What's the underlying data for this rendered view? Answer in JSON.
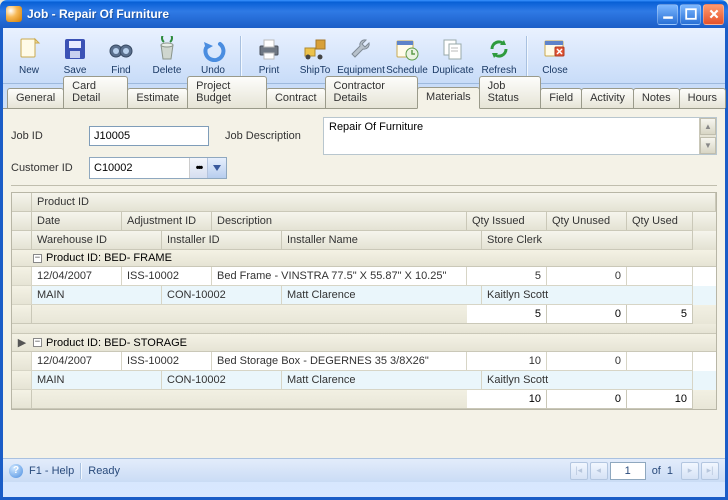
{
  "window": {
    "title": "Job - Repair Of Furniture"
  },
  "toolbar": [
    {
      "name": "new",
      "label": "New"
    },
    {
      "name": "save",
      "label": "Save"
    },
    {
      "name": "find",
      "label": "Find"
    },
    {
      "name": "delete",
      "label": "Delete"
    },
    {
      "name": "undo",
      "label": "Undo"
    },
    {
      "name": "print",
      "label": "Print"
    },
    {
      "name": "shipto",
      "label": "ShipTo"
    },
    {
      "name": "equipment",
      "label": "Equipment"
    },
    {
      "name": "schedule",
      "label": "Schedule"
    },
    {
      "name": "duplicate",
      "label": "Duplicate"
    },
    {
      "name": "refresh",
      "label": "Refresh"
    },
    {
      "name": "close",
      "label": "Close"
    }
  ],
  "tabs": [
    "General",
    "Card Detail",
    "Estimate",
    "Project Budget",
    "Contract",
    "Contractor Details",
    "Materials",
    "Job Status",
    "Field",
    "Activity",
    "Notes",
    "Hours"
  ],
  "active_tab": "Materials",
  "form": {
    "job_id_label": "Job ID",
    "job_id": "J10005",
    "customer_id_label": "Customer ID",
    "customer_id": "C10002",
    "job_desc_label": "Job Description",
    "job_desc": "Repair Of Furniture"
  },
  "grid": {
    "head_product": "Product ID",
    "head_date": "Date",
    "head_adj": "Adjustment ID",
    "head_desc": "Description",
    "head_qty_issued": "Qty Issued",
    "head_qty_unused": "Qty Unused",
    "head_qty_used": "Qty Used",
    "head_wh": "Warehouse ID",
    "head_installer_id": "Installer ID",
    "head_installer_name": "Installer Name",
    "head_clerk": "Store Clerk",
    "groups": [
      {
        "title": "Product ID: BED- FRAME",
        "row": {
          "date": "12/04/2007",
          "adj": "ISS-10002",
          "desc": "Bed Frame - VINSTRA 77.5\" X 55.87\" X 10.25\"",
          "qi": "5",
          "qu": "0",
          "qused": ""
        },
        "row2": {
          "wh": "MAIN",
          "iid": "CON-10002",
          "iname": "Matt Clarence",
          "clerk": "Kaitlyn Scott"
        },
        "totals": {
          "qi": "5",
          "qu": "0",
          "qused": "5"
        }
      },
      {
        "title": "Product ID: BED- STORAGE",
        "row": {
          "date": "12/04/2007",
          "adj": "ISS-10002",
          "desc": "Bed Storage Box - DEGERNES 35 3/8X26\"",
          "qi": "10",
          "qu": "0",
          "qused": ""
        },
        "row2": {
          "wh": "MAIN",
          "iid": "CON-10002",
          "iname": "Matt Clarence",
          "clerk": "Kaitlyn Scott"
        },
        "totals": {
          "qi": "10",
          "qu": "0",
          "qused": "10"
        }
      }
    ]
  },
  "status": {
    "help": "F1 - Help",
    "ready": "Ready",
    "page": "1",
    "of_label": "of",
    "total": "1"
  }
}
